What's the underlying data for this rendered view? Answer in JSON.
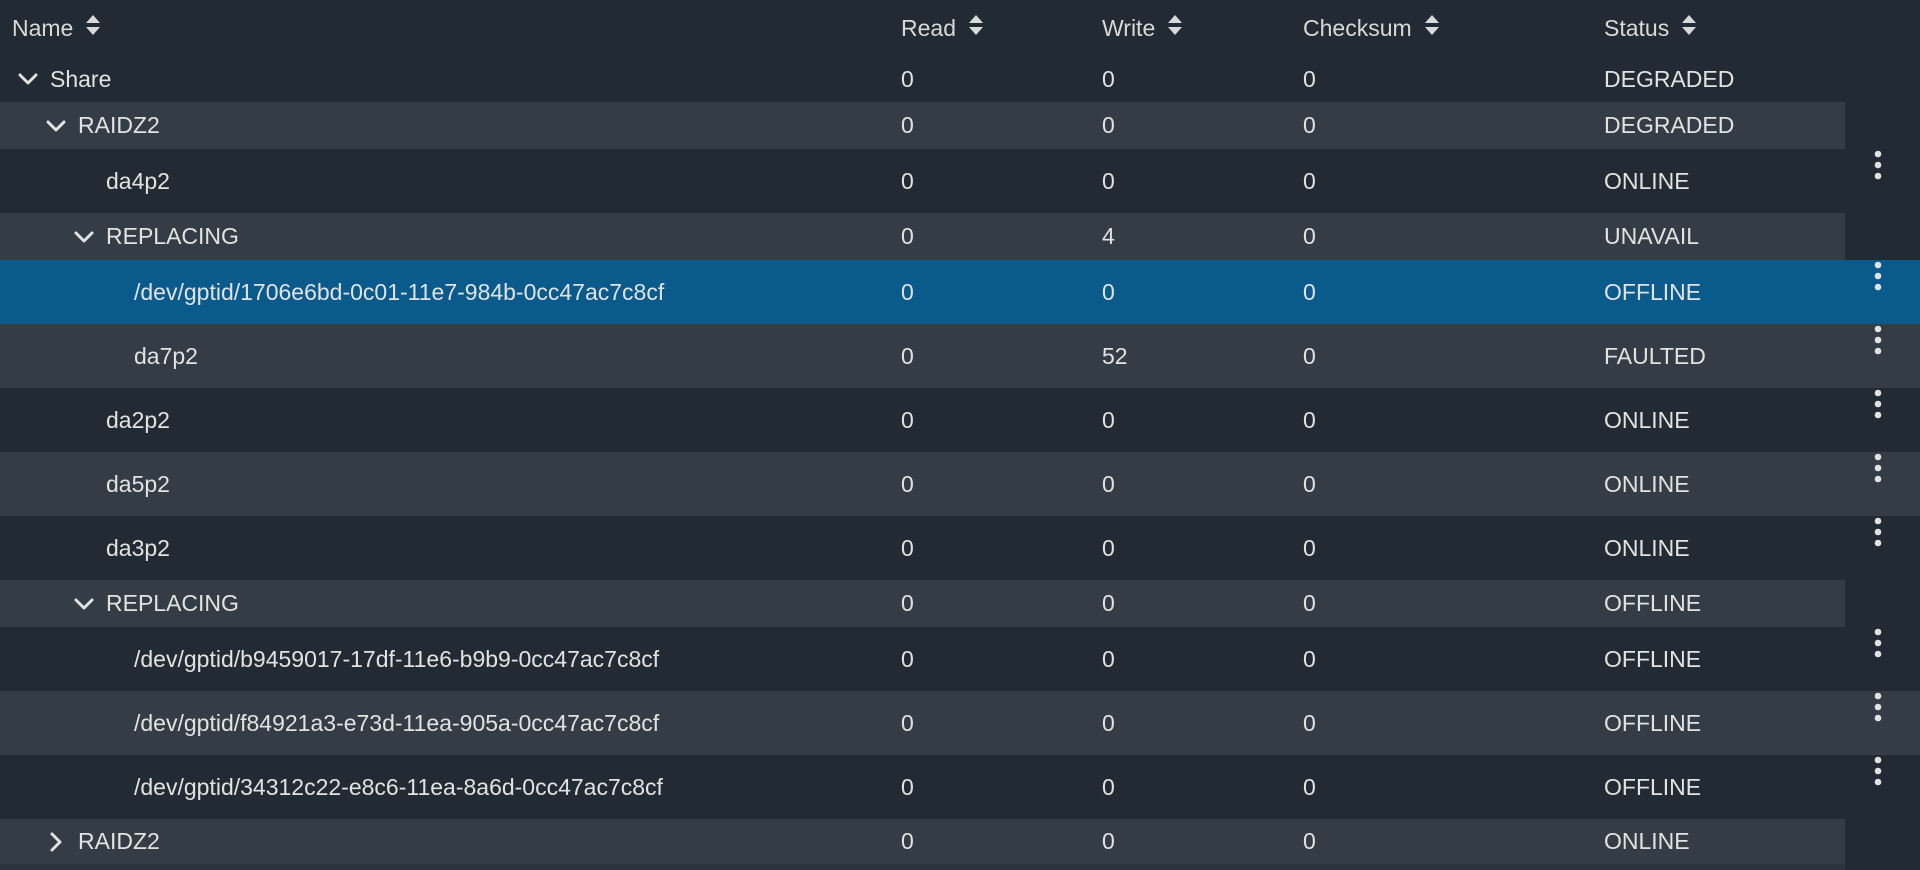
{
  "columns": {
    "name": "Name",
    "read": "Read",
    "write": "Write",
    "checksum": "Checksum",
    "status": "Status"
  },
  "icons": {
    "sort": "sort-icon",
    "expand": "chevron-down-icon",
    "collapsed": "chevron-right-icon",
    "menu": "more-vertical-icon"
  },
  "colors": {
    "background": "#222b33",
    "row_alt": "#343d46",
    "selected": "#0b5a8c",
    "text": "#dfe3e6"
  },
  "rows": [
    {
      "name": "Share",
      "read": "0",
      "write": "0",
      "checksum": "0",
      "status": "DEGRADED",
      "expander": "expanded",
      "menu": false,
      "selected": false
    },
    {
      "name": "RAIDZ2",
      "read": "0",
      "write": "0",
      "checksum": "0",
      "status": "DEGRADED",
      "expander": "expanded",
      "menu": false,
      "selected": false
    },
    {
      "name": "da4p2",
      "read": "0",
      "write": "0",
      "checksum": "0",
      "status": "ONLINE",
      "expander": "",
      "menu": true,
      "selected": false
    },
    {
      "name": "REPLACING",
      "read": "0",
      "write": "4",
      "checksum": "0",
      "status": "UNAVAIL",
      "expander": "expanded",
      "menu": false,
      "selected": false
    },
    {
      "name": "/dev/gptid/1706e6bd-0c01-11e7-984b-0cc47ac7c8cf",
      "read": "0",
      "write": "0",
      "checksum": "0",
      "status": "OFFLINE",
      "expander": "",
      "menu": true,
      "selected": true
    },
    {
      "name": "da7p2",
      "read": "0",
      "write": "52",
      "checksum": "0",
      "status": "FAULTED",
      "expander": "",
      "menu": true,
      "selected": false
    },
    {
      "name": "da2p2",
      "read": "0",
      "write": "0",
      "checksum": "0",
      "status": "ONLINE",
      "expander": "",
      "menu": true,
      "selected": false
    },
    {
      "name": "da5p2",
      "read": "0",
      "write": "0",
      "checksum": "0",
      "status": "ONLINE",
      "expander": "",
      "menu": true,
      "selected": false
    },
    {
      "name": "da3p2",
      "read": "0",
      "write": "0",
      "checksum": "0",
      "status": "ONLINE",
      "expander": "",
      "menu": true,
      "selected": false
    },
    {
      "name": "REPLACING",
      "read": "0",
      "write": "0",
      "checksum": "0",
      "status": "OFFLINE",
      "expander": "expanded",
      "menu": false,
      "selected": false
    },
    {
      "name": "/dev/gptid/b9459017-17df-11e6-b9b9-0cc47ac7c8cf",
      "read": "0",
      "write": "0",
      "checksum": "0",
      "status": "OFFLINE",
      "expander": "",
      "menu": true,
      "selected": false
    },
    {
      "name": "/dev/gptid/f84921a3-e73d-11ea-905a-0cc47ac7c8cf",
      "read": "0",
      "write": "0",
      "checksum": "0",
      "status": "OFFLINE",
      "expander": "",
      "menu": true,
      "selected": false
    },
    {
      "name": "/dev/gptid/34312c22-e8c6-11ea-8a6d-0cc47ac7c8cf",
      "read": "0",
      "write": "0",
      "checksum": "0",
      "status": "OFFLINE",
      "expander": "",
      "menu": true,
      "selected": false
    },
    {
      "name": "RAIDZ2",
      "read": "0",
      "write": "0",
      "checksum": "0",
      "status": "ONLINE",
      "expander": "collapsed",
      "menu": false,
      "selected": false
    }
  ]
}
